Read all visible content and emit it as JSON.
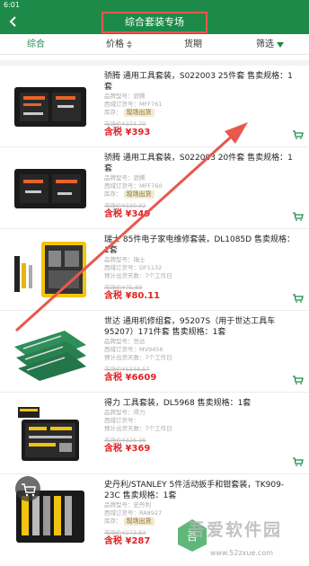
{
  "status": {
    "time": "6:01"
  },
  "header": {
    "title": "综合套装专场"
  },
  "sort": {
    "items": [
      {
        "label": "综合",
        "active": true
      },
      {
        "label": "价格",
        "active": false
      },
      {
        "label": "货期",
        "active": false
      },
      {
        "label": "筛选",
        "active": false
      }
    ]
  },
  "products": [
    {
      "name": "骄腾 通用工具套装，S022003 25件套 售卖规格：1套",
      "meta1": "品牌型号：骄腾",
      "meta2": "西域订货号：MFF761",
      "meta3": "库存：",
      "badge": "现场出货",
      "orig": "市场价¥374.70",
      "price": "含税 ¥393"
    },
    {
      "name": "骄腾 通用工具套装，S022003 20件套 售卖规格：1套",
      "meta1": "品牌型号：骄腾",
      "meta2": "西域订货号：MFF760",
      "meta3": "库存：",
      "badge": "现场出货",
      "orig": "市场价¥330.92",
      "price": "含税 ¥349"
    },
    {
      "name": "瑞士 85件电子家电维修套装，DL1085D 售卖规格：1套",
      "meta1": "品牌型号：瑞士",
      "meta2": "西域订货号：DF1132",
      "meta3": "预计出货天数：7个工作日",
      "badge": "",
      "orig": "市场价¥75.89",
      "price": "含税 ¥80.11"
    },
    {
      "name": "世达 通用机修组套，95207S（用于世达工具车95207）171件套 售卖规格：1套",
      "meta1": "品牌型号：世达",
      "meta2": "西域订货号：MV9456",
      "meta3": "预计出货天数：7个工作日",
      "badge": "",
      "orig": "市场价¥6348.57",
      "price": "含税 ¥6609"
    },
    {
      "name": "得力 工具套装，DL5968 售卖规格：1套",
      "meta1": "品牌型号：得力",
      "meta2": "西域订货号：",
      "meta3": "预计出货天数：7个工作日",
      "badge": "",
      "orig": "市场价¥326.36",
      "price": "含税 ¥369"
    },
    {
      "name": "史丹利/STANLEY 5件活动扳手和钳套装，TK909-23C 售卖规格：1套",
      "meta1": "品牌型号：史丹利",
      "meta2": "西域订货号：RA8927",
      "meta3": "库存：",
      "badge": "现场出货",
      "orig": "市场价¥273.83",
      "price": "含税 ¥287"
    }
  ],
  "watermark": {
    "word": "吾爱软件园",
    "site": "www.52zxue.com"
  },
  "colors": {
    "brand": "#1d8a4a",
    "price": "#e02424",
    "highlight": "#e8584d"
  }
}
